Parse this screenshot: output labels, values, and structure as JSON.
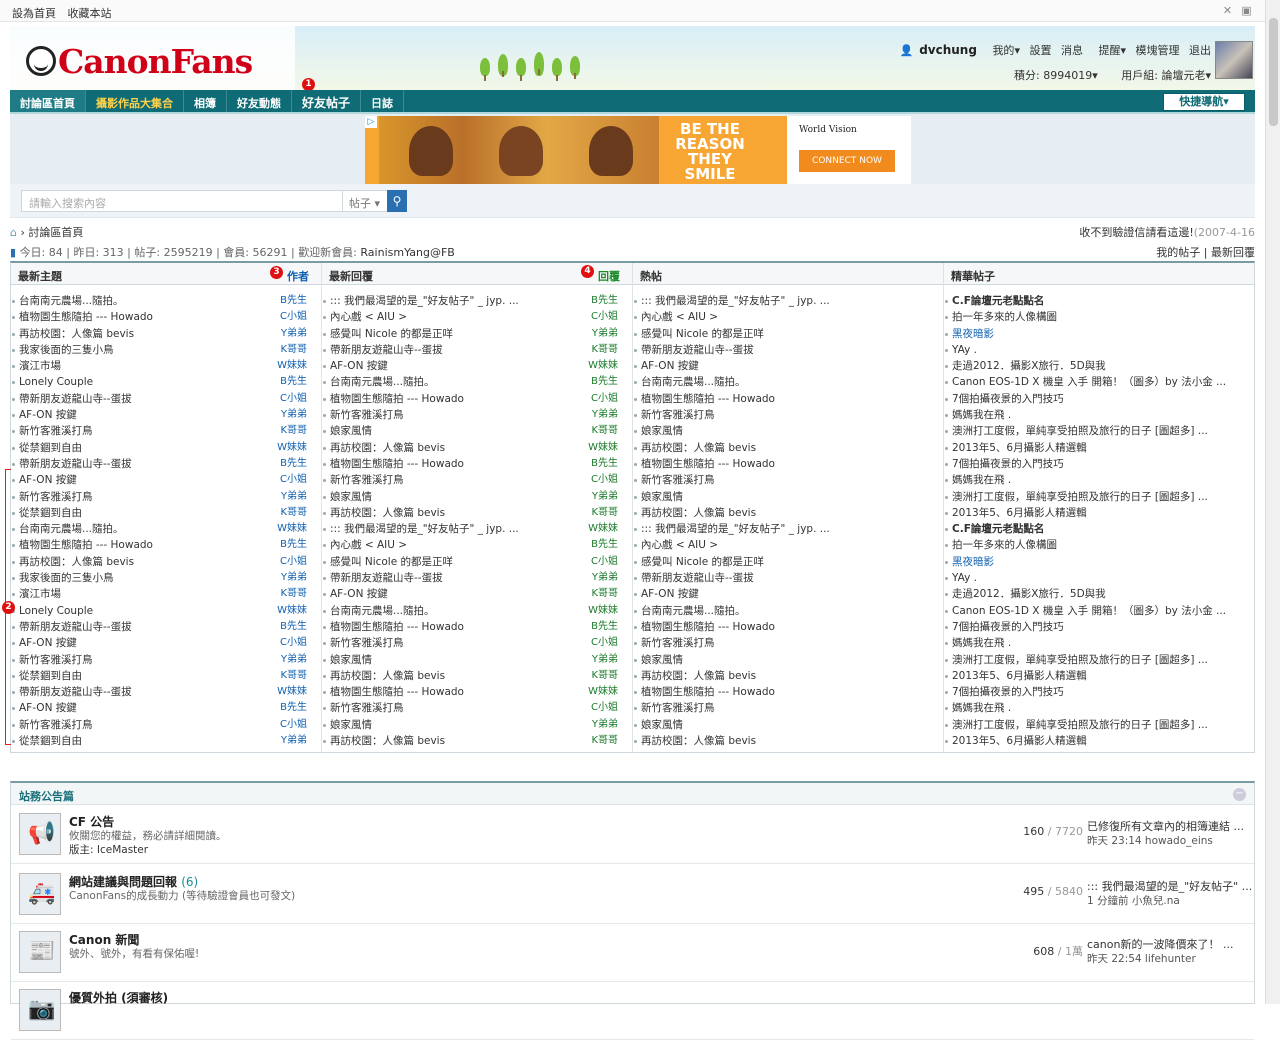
{
  "topbar": {
    "set_home": "設為首頁",
    "bookmark": "收藏本站"
  },
  "logo": {
    "text": "CanonFans"
  },
  "user": {
    "name": "dvchung",
    "my": "我的",
    "settings": "設置",
    "messages": "消息",
    "reminders": "提醒",
    "mod": "模塊管理",
    "logout": "退出",
    "points": "積分: 8994019",
    "group": "用戶組: 論壇元老"
  },
  "badges": {
    "b1": "1",
    "b2": "2",
    "b3": "3",
    "b4": "4"
  },
  "nav": {
    "items": [
      "討論區首頁",
      "攝影作品大集合",
      "相簿",
      "好友動態",
      "好友帖子",
      "日誌"
    ],
    "quick": "快捷導航"
  },
  "ad": {
    "headline": "BE THE REASON THEY SMILE",
    "brand": "World Vision",
    "cta": "CONNECT NOW",
    "choice": "▷"
  },
  "search": {
    "placeholder": "請輸入搜索內容",
    "type": "帖子"
  },
  "breadcrumb": {
    "home": "討論區首頁",
    "notice": "收不到驗證信請看這邊!",
    "notice_date": "(2007-4-16"
  },
  "stats": {
    "today": "今日: 84",
    "yesterday": "昨日: 313",
    "posts": "帖子: 2595219",
    "members": "會員: 56291",
    "welcome": "歡迎新會員:",
    "newuser": "RainismYang@FB",
    "myposts": "我的帖子",
    "latest_replies": "最新回覆"
  },
  "grid": {
    "headers": [
      "最新主題",
      "作者",
      "最新回覆",
      "回覆",
      "熱帖",
      "精華帖子"
    ],
    "col1": [
      "台南南元農場...隨拍。",
      "植物園生態隨拍 --- Howado",
      "再訪校園：人像篇 bevis",
      "我家後面的三隻小鳥",
      "濱江市場",
      "Lonely Couple",
      "帶新朋友遊龍山寺--蛋拔",
      "AF-ON 按鍵",
      "新竹客雅溪打鳥",
      "從禁錮到自由",
      "帶新朋友遊龍山寺--蛋拔",
      "AF-ON 按鍵",
      "新竹客雅溪打鳥",
      "從禁錮到自由",
      "台南南元農場...隨拍。",
      "植物園生態隨拍 --- Howado",
      "再訪校園：人像篇 bevis",
      "我家後面的三隻小鳥",
      "濱江市場",
      "Lonely Couple",
      "帶新朋友遊龍山寺--蛋拔",
      "AF-ON 按鍵",
      "新竹客雅溪打鳥",
      "從禁錮到自由",
      "帶新朋友遊龍山寺--蛋拔",
      "AF-ON 按鍵",
      "新竹客雅溪打鳥",
      "從禁錮到自由"
    ],
    "authors1": [
      "B先生",
      "C小姐",
      "Y弟弟",
      "K哥哥",
      "W妹妹",
      "B先生",
      "C小姐",
      "Y弟弟",
      "K哥哥",
      "W妹妹",
      "B先生",
      "C小姐",
      "Y弟弟",
      "K哥哥",
      "W妹妹",
      "B先生",
      "C小姐",
      "Y弟弟",
      "K哥哥",
      "W妹妹",
      "B先生",
      "C小姐",
      "Y弟弟",
      "K哥哥",
      "W妹妹",
      "B先生",
      "C小姐",
      "Y弟弟",
      "K哥哥"
    ],
    "col2": [
      "::: 我們最渴望的是_\"好友帖子\" _ jyp. ...",
      "內心戲 < AIU >",
      "感覺叫 Nicole 的都是正咩",
      "帶新朋友遊龍山寺--蛋拔",
      "AF-ON 按鍵",
      "台南南元農場...隨拍。",
      "植物園生態隨拍 --- Howado",
      "新竹客雅溪打鳥",
      "娘家風情",
      "再訪校園：人像篇 bevis",
      "植物園生態隨拍 --- Howado",
      "新竹客雅溪打鳥",
      "娘家風情",
      "再訪校園：人像篇 bevis",
      "::: 我們最渴望的是_\"好友帖子\" _ jyp. ...",
      "內心戲 < AIU >",
      "感覺叫 Nicole 的都是正咩",
      "帶新朋友遊龍山寺--蛋拔",
      "AF-ON 按鍵",
      "台南南元農場...隨拍。",
      "植物園生態隨拍 --- Howado",
      "新竹客雅溪打鳥",
      "娘家風情",
      "再訪校園：人像篇 bevis",
      "植物園生態隨拍 --- Howado",
      "新竹客雅溪打鳥",
      "娘家風情",
      "再訪校園：人像篇 bevis"
    ],
    "authors2": [
      "B先生",
      "C小姐",
      "Y弟弟",
      "K哥哥",
      "W妹妹",
      "B先生",
      "C小姐",
      "Y弟弟",
      "K哥哥",
      "W妹妹",
      "B先生",
      "C小姐",
      "Y弟弟",
      "K哥哥",
      "W妹妹",
      "B先生",
      "C小姐",
      "Y弟弟",
      "K哥哥",
      "W妹妹",
      "B先生",
      "C小姐",
      "Y弟弟",
      "K哥哥",
      "W妹妹",
      "C小姐",
      "Y弟弟",
      "K哥哥"
    ],
    "col3": [
      "::: 我們最渴望的是_\"好友帖子\" _ jyp. ...",
      "內心戲 < AIU >",
      "感覺叫 Nicole 的都是正咩",
      "帶新朋友遊龍山寺--蛋拔",
      "AF-ON 按鍵",
      "台南南元農場...隨拍。",
      "植物園生態隨拍 --- Howado",
      "新竹客雅溪打鳥",
      "娘家風情",
      "再訪校園：人像篇 bevis",
      "植物園生態隨拍 --- Howado",
      "新竹客雅溪打鳥",
      "娘家風情",
      "再訪校園：人像篇 bevis",
      "::: 我們最渴望的是_\"好友帖子\" _ jyp. ...",
      "內心戲 < AIU >",
      "感覺叫 Nicole 的都是正咩",
      "帶新朋友遊龍山寺--蛋拔",
      "AF-ON 按鍵",
      "台南南元農場...隨拍。",
      "植物園生態隨拍 --- Howado",
      "新竹客雅溪打鳥",
      "娘家風情",
      "再訪校園：人像篇 bevis",
      "植物園生態隨拍 --- Howado",
      "新竹客雅溪打鳥",
      "娘家風情",
      "再訪校園：人像篇 bevis"
    ],
    "col4": [
      "C.F論壇元老點點名",
      "拍一年多來的人像構圖",
      "黑夜暗影",
      "YAy .",
      "走過2012．攝影X旅行．5D與我",
      "Canon EOS-1D X 機皇 入手 開箱！（圖多）by 法小金 ...",
      "7個拍攝夜景的入門技巧",
      "媽媽我在飛 .",
      "澳洲打工度假，單純享受拍照及旅行的日子 [圖超多] ...",
      "2013年5、6月攝影人精選輯",
      "7個拍攝夜景的入門技巧",
      "媽媽我在飛 .",
      "澳洲打工度假，單純享受拍照及旅行的日子 [圖超多] ...",
      "2013年5、6月攝影人精選輯",
      "C.F論壇元老點點名",
      "拍一年多來的人像構圖",
      "黑夜暗影",
      "YAy .",
      "走過2012．攝影X旅行．5D與我",
      "Canon EOS-1D X 機皇 入手 開箱！（圖多）by 法小金 ...",
      "7個拍攝夜景的入門技巧",
      "媽媽我在飛 .",
      "澳洲打工度假，單純享受拍照及旅行的日子 [圖超多] ...",
      "2013年5、6月攝影人精選輯",
      "7個拍攝夜景的入門技巧",
      "媽媽我在飛 .",
      "澳洲打工度假，單純享受拍照及旅行的日子 [圖超多] ...",
      "2013年5、6月攝影人精選輯"
    ]
  },
  "notice": {
    "title": "站務公告篇",
    "collapse": "−"
  },
  "forums": [
    {
      "name": "CF 公告",
      "count": "",
      "desc": "攸關您的權益，務必請詳細閱讀。",
      "mod_label": "版主:",
      "mod": "IceMaster",
      "threads": "160",
      "posts": "/ 7720",
      "last_title": "已修復所有文章內的相簿連結 ...",
      "last_meta": "昨天 23:14 howado_eins",
      "icon": "📢"
    },
    {
      "name": "網站建議與問題回報",
      "count": "(6)",
      "desc": "CanonFans的成長動力 (等待驗證會員也可發文)",
      "mod_label": "",
      "mod": "",
      "threads": "495",
      "posts": "/ 5840",
      "last_title": "::: 我們最渴望的是_\"好友帖子\" ...",
      "last_meta": "1 分鐘前 小魚兒.na",
      "icon": "🚑"
    },
    {
      "name": "Canon 新聞",
      "count": "",
      "desc": "號外、號外，有看有保佑喔!",
      "mod_label": "",
      "mod": "",
      "threads": "608",
      "posts": "/ 1萬",
      "last_title": "canon新的一波降價來了！ ...",
      "last_meta": "昨天 22:54 lifehunter",
      "icon": "📰"
    },
    {
      "name": "優質外拍 (須審核)",
      "count": "",
      "desc": "",
      "mod_label": "",
      "mod": "",
      "threads": "",
      "posts": "",
      "last_title": "",
      "last_meta": "",
      "icon": "📷"
    }
  ]
}
